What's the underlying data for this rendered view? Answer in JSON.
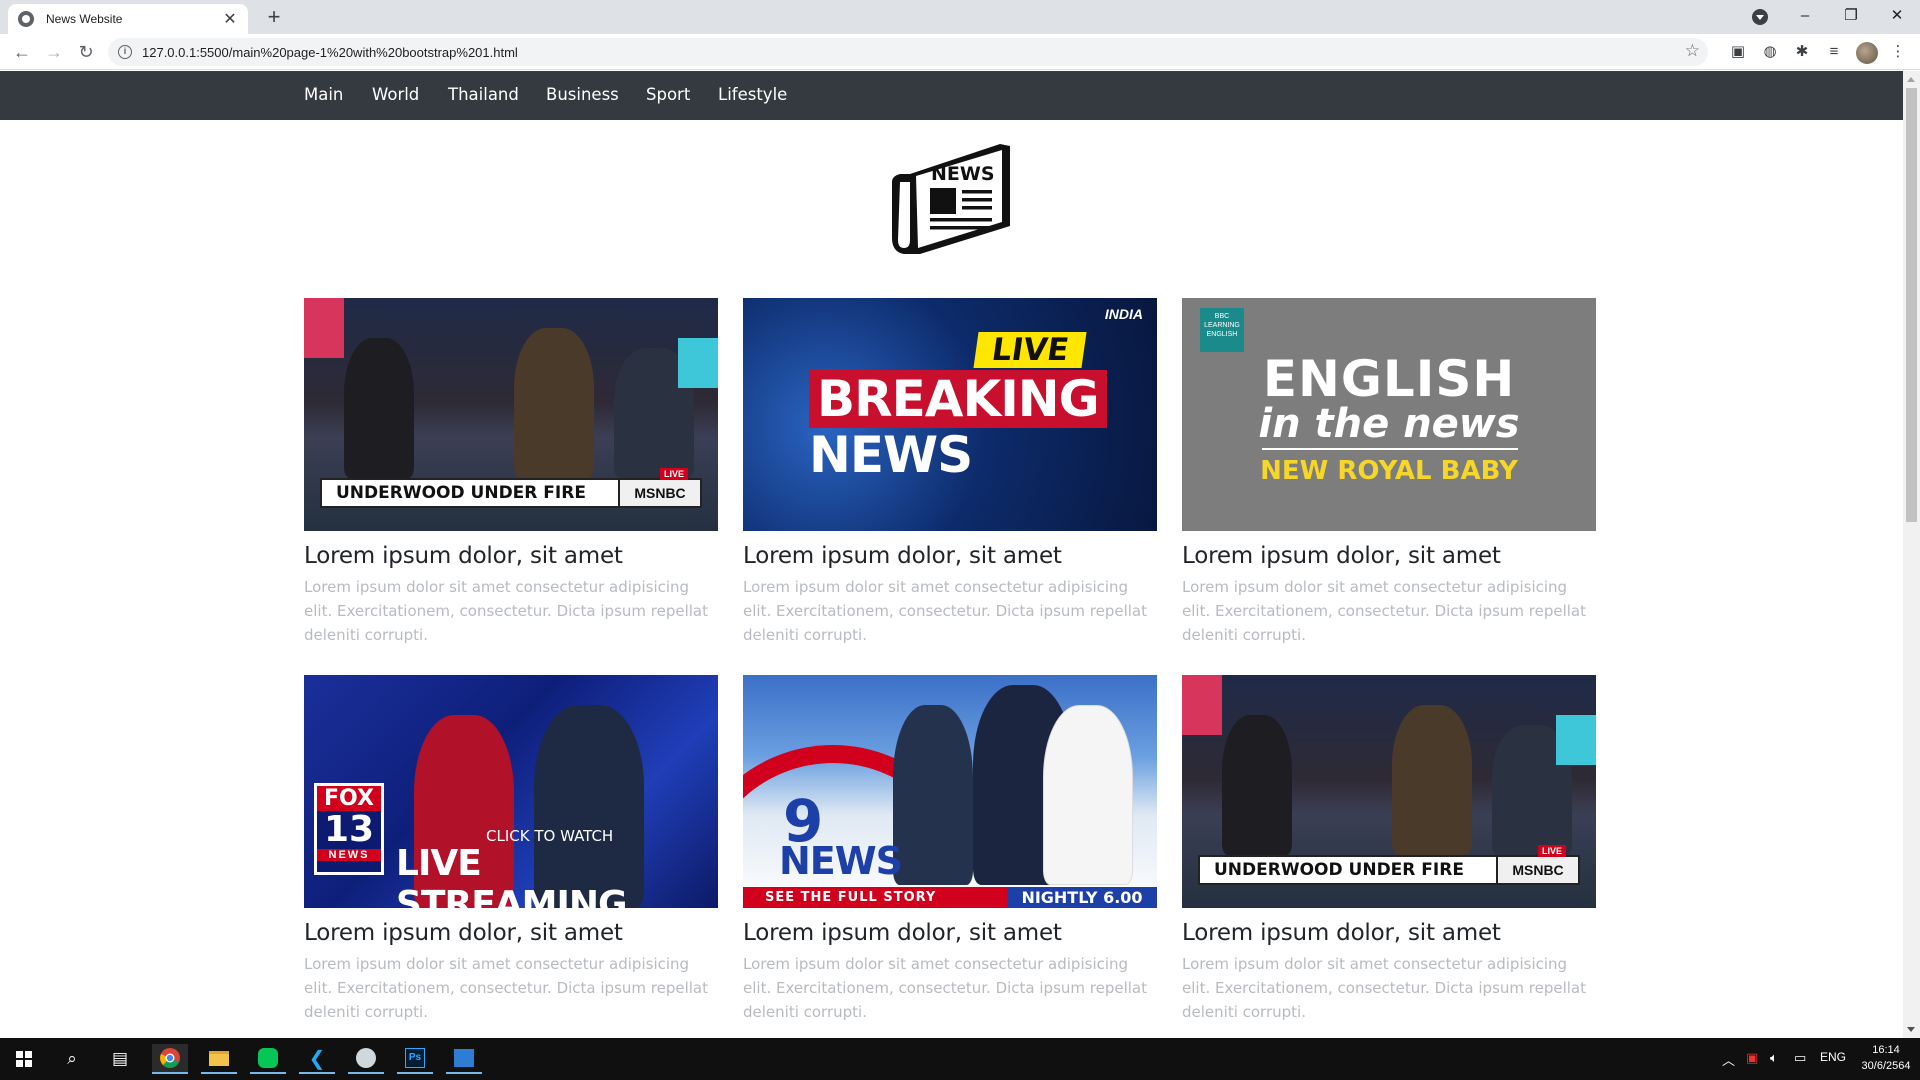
{
  "browser": {
    "tab_title": "News Website",
    "url": "127.0.0.1:5500/main%20page-1%20with%20bootstrap%201.html"
  },
  "site": {
    "nav": [
      "Main",
      "World",
      "Thailand",
      "Business",
      "Sport",
      "Lifestyle"
    ],
    "logo_text": "NEWS"
  },
  "cards": [
    {
      "title": "Lorem ipsum dolor, sit amet",
      "text": "Lorem ipsum dolor sit amet consectetur adipisicing elit. Exercitationem, consectetur. Dicta ipsum repellat deleniti corrupti.",
      "thumb": {
        "headline": "UNDERWOOD UNDER FIRE",
        "brand": "MSNBC",
        "badge": "LIVE"
      }
    },
    {
      "title": "Lorem ipsum dolor, sit amet",
      "text": "Lorem ipsum dolor sit amet consectetur adipisicing elit. Exercitationem, consectetur. Dicta ipsum repellat deleniti corrupti.",
      "thumb": {
        "live": "LIVE",
        "breaking": "BREAKING",
        "news": "NEWS",
        "brand": "INDIA"
      }
    },
    {
      "title": "Lorem ipsum dolor, sit amet",
      "text": "Lorem ipsum dolor sit amet consectetur adipisicing elit. Exercitationem, consectetur. Dicta ipsum repellat deleniti corrupti.",
      "thumb": {
        "badge": "BBC LEARNING ENGLISH",
        "main": "ENGLISH",
        "sub": "in the news",
        "tag": "NEW ROYAL BABY"
      }
    },
    {
      "title": "Lorem ipsum dolor, sit amet",
      "text": "Lorem ipsum dolor sit amet consectetur adipisicing elit. Exercitationem, consectetur. Dicta ipsum repellat deleniti corrupti.",
      "thumb": {
        "fox": "FOX",
        "num": "13",
        "news": "NEWS",
        "click": "CLICK TO WATCH",
        "live": "LIVE STREAMING"
      }
    },
    {
      "title": "Lorem ipsum dolor, sit amet",
      "text": "Lorem ipsum dolor sit amet consectetur adipisicing elit. Exercitationem, consectetur. Dicta ipsum repellat deleniti corrupti.",
      "thumb": {
        "nine": "9",
        "news": "NEWS",
        "see": "SEE THE FULL STORY",
        "nightly": "NIGHTLY 6.00"
      }
    },
    {
      "title": "Lorem ipsum dolor, sit amet",
      "text": "Lorem ipsum dolor sit amet consectetur adipisicing elit. Exercitationem, consectetur. Dicta ipsum repellat deleniti corrupti.",
      "thumb": {
        "headline": "UNDERWOOD UNDER FIRE",
        "brand": "MSNBC",
        "badge": "LIVE"
      }
    }
  ],
  "taskbar": {
    "lang": "ENG",
    "time": "16:14",
    "date": "30/6/2564"
  },
  "colors": {
    "navbar": "#343a40",
    "muted_text": "#b7bbc0",
    "title_text": "#212529"
  }
}
